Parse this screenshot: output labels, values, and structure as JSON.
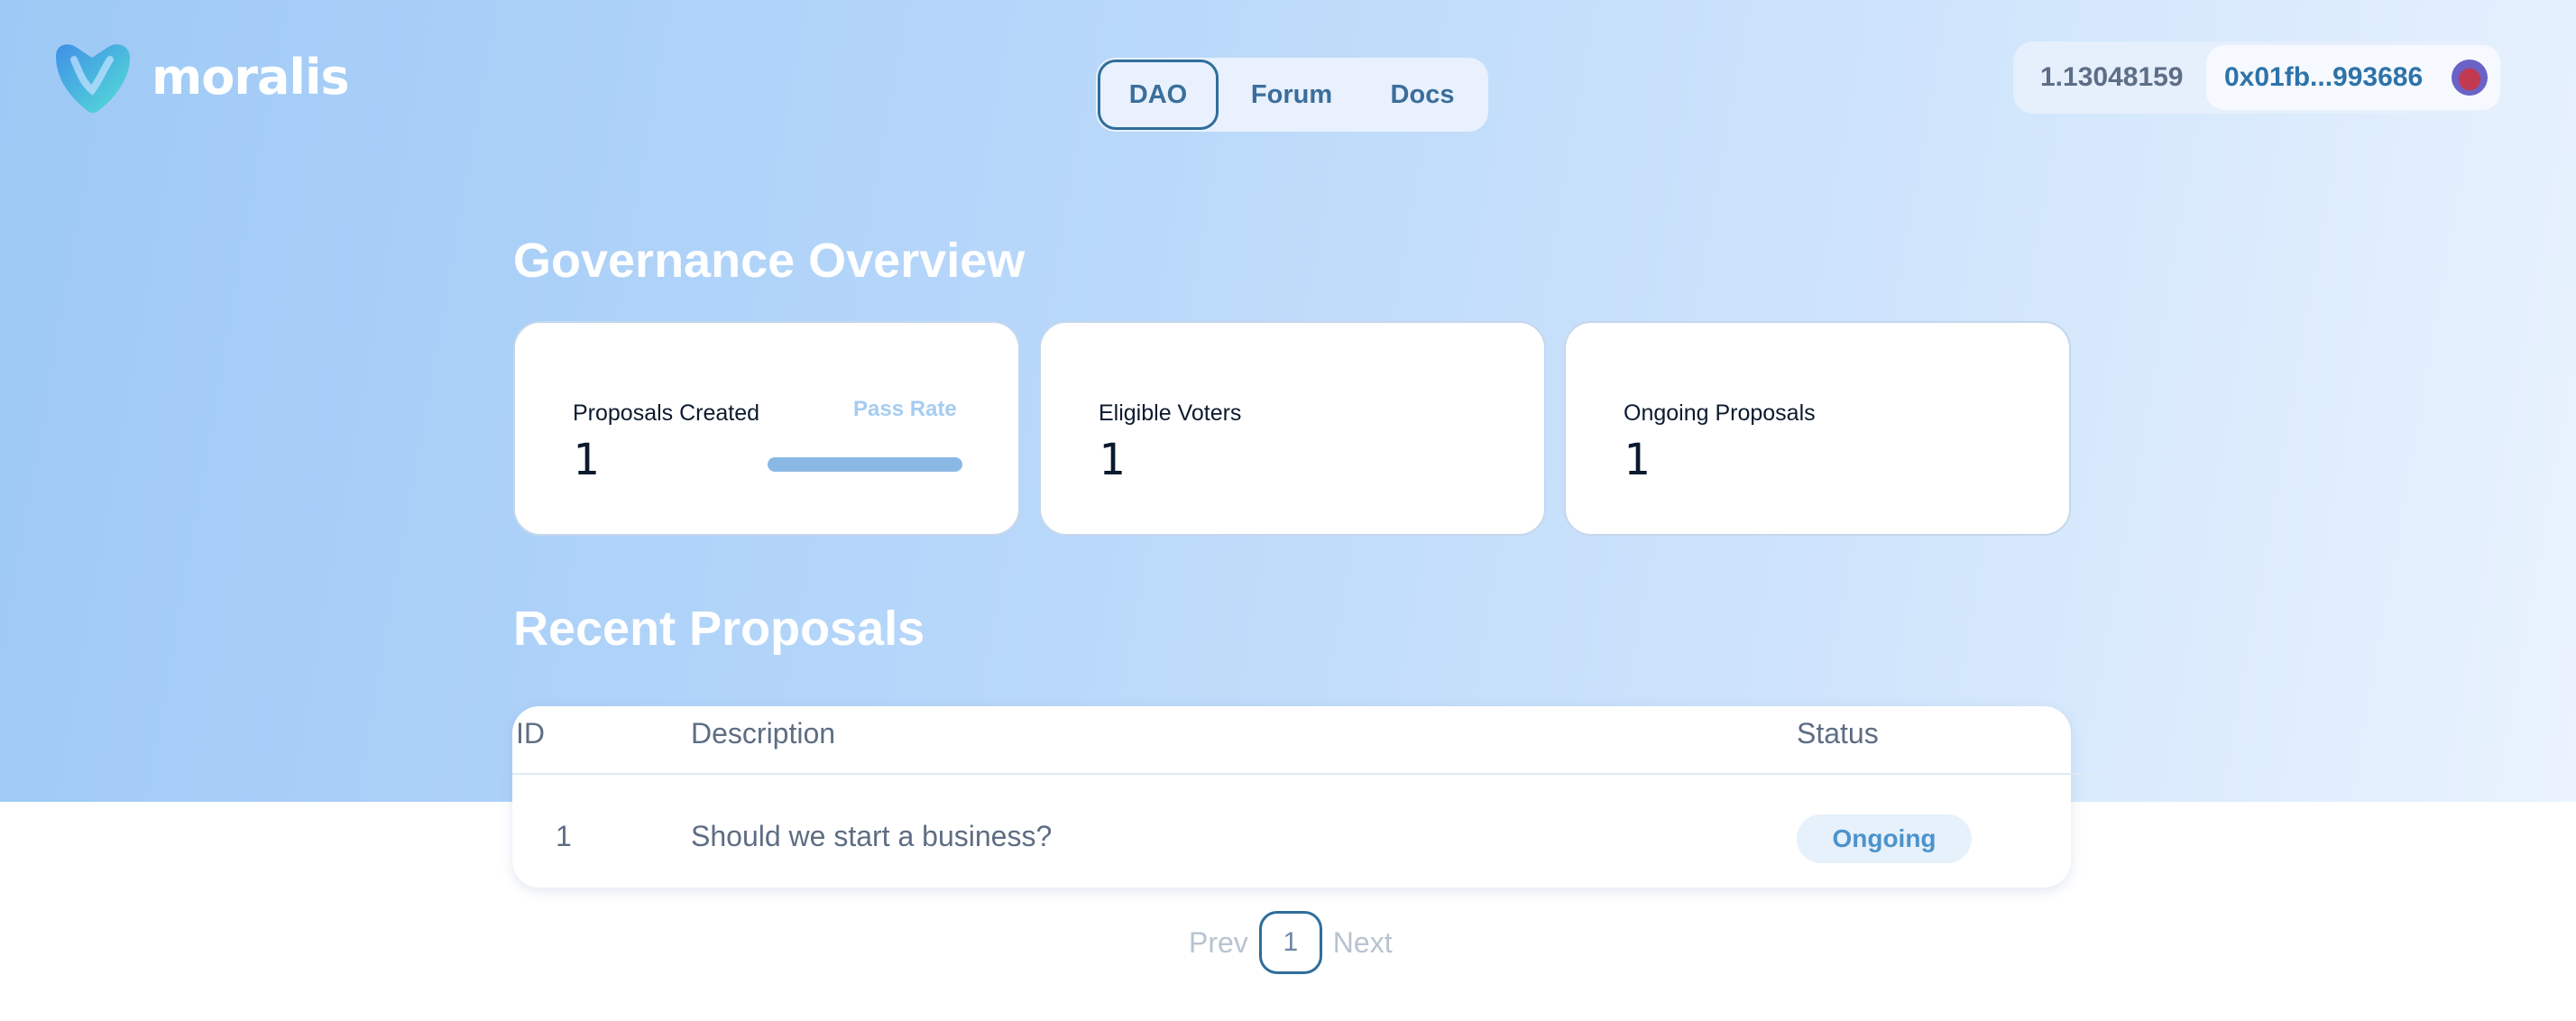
{
  "brand": {
    "name": "moralis",
    "logo_icon": "moralis-heart-logo"
  },
  "nav": {
    "items": [
      "DAO",
      "Forum",
      "Docs"
    ],
    "active": "DAO"
  },
  "account": {
    "balance": "1.13048159",
    "address": "0x01fb...993686",
    "avatar_icon": "wallet-avatar-icon"
  },
  "overview": {
    "title": "Governance Overview",
    "cards": [
      {
        "label": "Proposals Created",
        "value": "1",
        "pass_rate_label": "Pass Rate",
        "pass_rate": 1.0
      },
      {
        "label": "Eligible Voters",
        "value": "1"
      },
      {
        "label": "Ongoing Proposals",
        "value": "1"
      }
    ]
  },
  "proposals": {
    "title": "Recent Proposals",
    "columns": [
      "ID",
      "Description",
      "Status"
    ],
    "rows": [
      {
        "id": "1",
        "description": "Should we start a business?",
        "status": "Ongoing"
      }
    ]
  },
  "pagination": {
    "prev": "Prev",
    "current": "1",
    "next": "Next"
  },
  "colors": {
    "accent": "#2f6d9b",
    "hero_start": "#9ec9f6",
    "hero_end": "#eaf3fe",
    "status": "#4c93cc"
  }
}
